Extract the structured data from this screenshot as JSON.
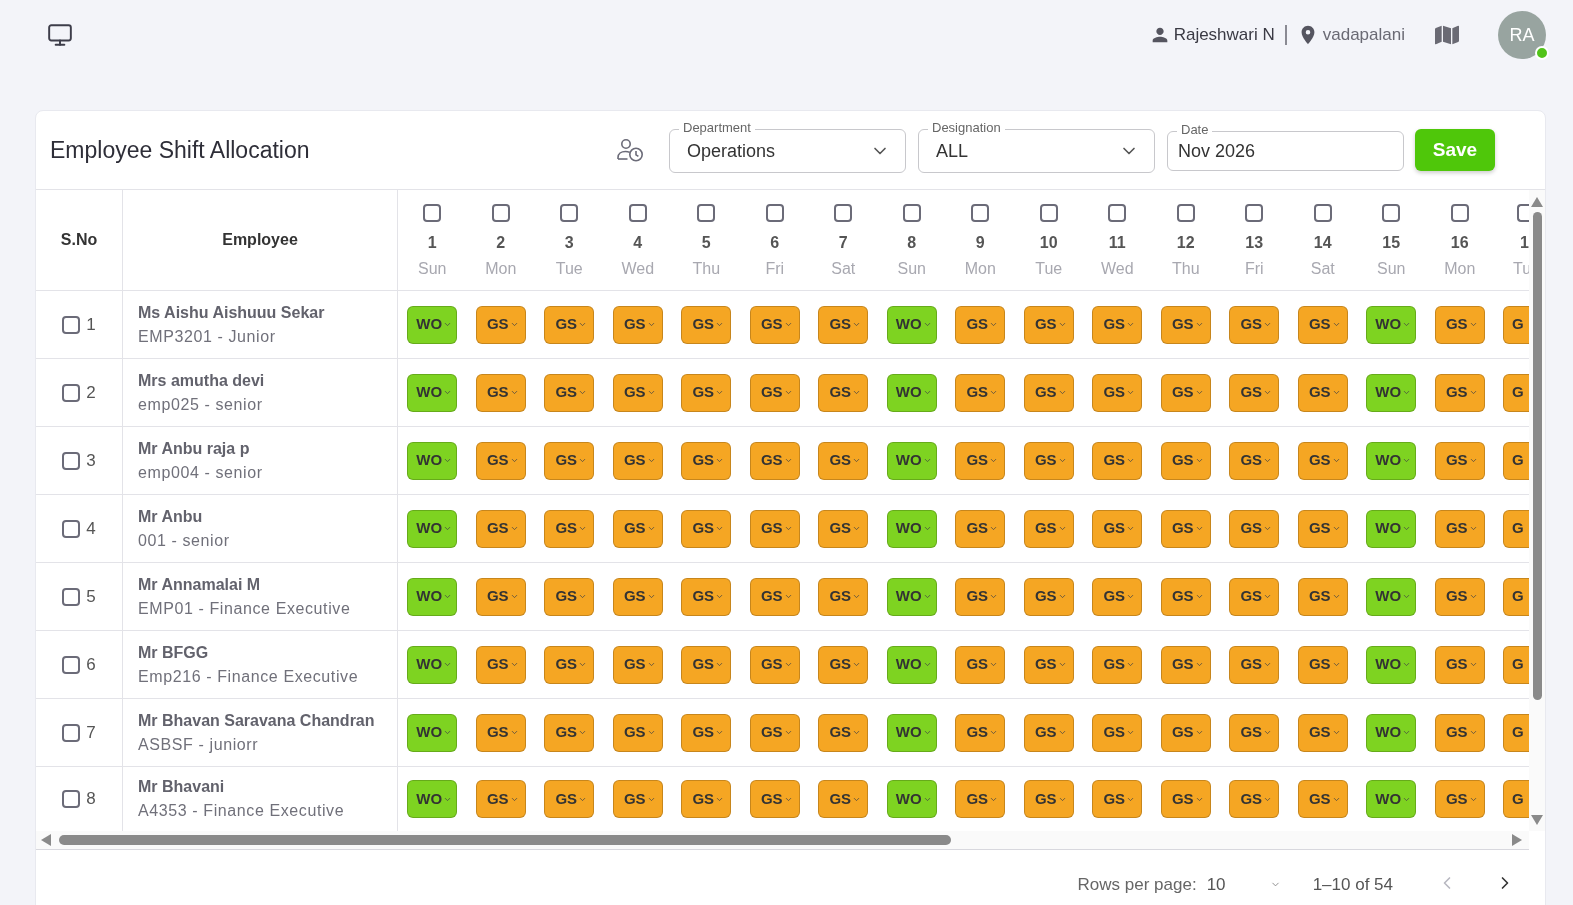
{
  "top_bar": {
    "user_name": "Rajeshwari N",
    "location": "vadapalani",
    "avatar_initials": "RA",
    "online": true
  },
  "page": {
    "title": "Employee Shift Allocation",
    "filters": [
      {
        "kind": "select",
        "label": "Department",
        "value": "Operations"
      },
      {
        "kind": "select",
        "label": "Designation",
        "value": "ALL"
      },
      {
        "kind": "date",
        "label": "Date",
        "value": "Nov 2026"
      }
    ],
    "save_button": "Save"
  },
  "table": {
    "columns": [
      "S.No",
      "Employee"
    ],
    "days": [
      {
        "number": "1",
        "weekday": "Sun",
        "checked": false
      },
      {
        "number": "2",
        "weekday": "Mon",
        "checked": false
      },
      {
        "number": "3",
        "weekday": "Tue",
        "checked": false
      },
      {
        "number": "4",
        "weekday": "Wed",
        "checked": false
      },
      {
        "number": "5",
        "weekday": "Thu",
        "checked": false
      },
      {
        "number": "6",
        "weekday": "Fri",
        "checked": false
      },
      {
        "number": "7",
        "weekday": "Sat",
        "checked": false
      },
      {
        "number": "8",
        "weekday": "Sun",
        "checked": false
      },
      {
        "number": "9",
        "weekday": "Mon",
        "checked": false
      },
      {
        "number": "10",
        "weekday": "Tue",
        "checked": false
      },
      {
        "number": "11",
        "weekday": "Wed",
        "checked": false
      },
      {
        "number": "12",
        "weekday": "Thu",
        "checked": false
      },
      {
        "number": "13",
        "weekday": "Fri",
        "checked": false
      },
      {
        "number": "14",
        "weekday": "Sat",
        "checked": false
      },
      {
        "number": "15",
        "weekday": "Sun",
        "checked": false
      },
      {
        "number": "16",
        "weekday": "Mon",
        "checked": false
      },
      {
        "number": "1",
        "weekday": "Tu",
        "checked": false
      }
    ],
    "rows": [
      {
        "sno": "1",
        "checked": false,
        "name": "Ms Aishu Aishuuu Sekar",
        "detail": "EMP3201 - Junior",
        "shifts": [
          {
            "code": "WO",
            "color": "#7ed321"
          },
          {
            "code": "GS",
            "color": "#f5a623"
          },
          {
            "code": "GS",
            "color": "#f5a623"
          },
          {
            "code": "GS",
            "color": "#f5a623"
          },
          {
            "code": "GS",
            "color": "#f5a623"
          },
          {
            "code": "GS",
            "color": "#f5a623"
          },
          {
            "code": "GS",
            "color": "#f5a623"
          },
          {
            "code": "WO",
            "color": "#7ed321"
          },
          {
            "code": "GS",
            "color": "#f5a623"
          },
          {
            "code": "GS",
            "color": "#f5a623"
          },
          {
            "code": "GS",
            "color": "#f5a623"
          },
          {
            "code": "GS",
            "color": "#f5a623"
          },
          {
            "code": "GS",
            "color": "#f5a623"
          },
          {
            "code": "GS",
            "color": "#f5a623"
          },
          {
            "code": "WO",
            "color": "#7ed321"
          },
          {
            "code": "GS",
            "color": "#f5a623"
          },
          {
            "code": "G",
            "color": "#f5a623"
          }
        ]
      },
      {
        "sno": "2",
        "checked": false,
        "name": "Mrs amutha devi",
        "detail": "emp025 - senior",
        "shifts": [
          {
            "code": "WO",
            "color": "#7ed321"
          },
          {
            "code": "GS",
            "color": "#f5a623"
          },
          {
            "code": "GS",
            "color": "#f5a623"
          },
          {
            "code": "GS",
            "color": "#f5a623"
          },
          {
            "code": "GS",
            "color": "#f5a623"
          },
          {
            "code": "GS",
            "color": "#f5a623"
          },
          {
            "code": "GS",
            "color": "#f5a623"
          },
          {
            "code": "WO",
            "color": "#7ed321"
          },
          {
            "code": "GS",
            "color": "#f5a623"
          },
          {
            "code": "GS",
            "color": "#f5a623"
          },
          {
            "code": "GS",
            "color": "#f5a623"
          },
          {
            "code": "GS",
            "color": "#f5a623"
          },
          {
            "code": "GS",
            "color": "#f5a623"
          },
          {
            "code": "GS",
            "color": "#f5a623"
          },
          {
            "code": "WO",
            "color": "#7ed321"
          },
          {
            "code": "GS",
            "color": "#f5a623"
          },
          {
            "code": "G",
            "color": "#f5a623"
          }
        ]
      },
      {
        "sno": "3",
        "checked": false,
        "name": "Mr Anbu raja p",
        "detail": "emp004 - senior",
        "shifts": [
          {
            "code": "WO",
            "color": "#7ed321"
          },
          {
            "code": "GS",
            "color": "#f5a623"
          },
          {
            "code": "GS",
            "color": "#f5a623"
          },
          {
            "code": "GS",
            "color": "#f5a623"
          },
          {
            "code": "GS",
            "color": "#f5a623"
          },
          {
            "code": "GS",
            "color": "#f5a623"
          },
          {
            "code": "GS",
            "color": "#f5a623"
          },
          {
            "code": "WO",
            "color": "#7ed321"
          },
          {
            "code": "GS",
            "color": "#f5a623"
          },
          {
            "code": "GS",
            "color": "#f5a623"
          },
          {
            "code": "GS",
            "color": "#f5a623"
          },
          {
            "code": "GS",
            "color": "#f5a623"
          },
          {
            "code": "GS",
            "color": "#f5a623"
          },
          {
            "code": "GS",
            "color": "#f5a623"
          },
          {
            "code": "WO",
            "color": "#7ed321"
          },
          {
            "code": "GS",
            "color": "#f5a623"
          },
          {
            "code": "G",
            "color": "#f5a623"
          }
        ]
      },
      {
        "sno": "4",
        "checked": false,
        "name": "Mr Anbu",
        "detail": "001 - senior",
        "shifts": [
          {
            "code": "WO",
            "color": "#7ed321"
          },
          {
            "code": "GS",
            "color": "#f5a623"
          },
          {
            "code": "GS",
            "color": "#f5a623"
          },
          {
            "code": "GS",
            "color": "#f5a623"
          },
          {
            "code": "GS",
            "color": "#f5a623"
          },
          {
            "code": "GS",
            "color": "#f5a623"
          },
          {
            "code": "GS",
            "color": "#f5a623"
          },
          {
            "code": "WO",
            "color": "#7ed321"
          },
          {
            "code": "GS",
            "color": "#f5a623"
          },
          {
            "code": "GS",
            "color": "#f5a623"
          },
          {
            "code": "GS",
            "color": "#f5a623"
          },
          {
            "code": "GS",
            "color": "#f5a623"
          },
          {
            "code": "GS",
            "color": "#f5a623"
          },
          {
            "code": "GS",
            "color": "#f5a623"
          },
          {
            "code": "WO",
            "color": "#7ed321"
          },
          {
            "code": "GS",
            "color": "#f5a623"
          },
          {
            "code": "G",
            "color": "#f5a623"
          }
        ]
      },
      {
        "sno": "5",
        "checked": false,
        "name": "Mr Annamalai M",
        "detail": "EMP01 - Finance Executive",
        "shifts": [
          {
            "code": "WO",
            "color": "#7ed321"
          },
          {
            "code": "GS",
            "color": "#f5a623"
          },
          {
            "code": "GS",
            "color": "#f5a623"
          },
          {
            "code": "GS",
            "color": "#f5a623"
          },
          {
            "code": "GS",
            "color": "#f5a623"
          },
          {
            "code": "GS",
            "color": "#f5a623"
          },
          {
            "code": "GS",
            "color": "#f5a623"
          },
          {
            "code": "WO",
            "color": "#7ed321"
          },
          {
            "code": "GS",
            "color": "#f5a623"
          },
          {
            "code": "GS",
            "color": "#f5a623"
          },
          {
            "code": "GS",
            "color": "#f5a623"
          },
          {
            "code": "GS",
            "color": "#f5a623"
          },
          {
            "code": "GS",
            "color": "#f5a623"
          },
          {
            "code": "GS",
            "color": "#f5a623"
          },
          {
            "code": "WO",
            "color": "#7ed321"
          },
          {
            "code": "GS",
            "color": "#f5a623"
          },
          {
            "code": "G",
            "color": "#f5a623"
          }
        ]
      },
      {
        "sno": "6",
        "checked": false,
        "name": "Mr BFGG",
        "detail": "Emp216 - Finance Executive",
        "shifts": [
          {
            "code": "WO",
            "color": "#7ed321"
          },
          {
            "code": "GS",
            "color": "#f5a623"
          },
          {
            "code": "GS",
            "color": "#f5a623"
          },
          {
            "code": "GS",
            "color": "#f5a623"
          },
          {
            "code": "GS",
            "color": "#f5a623"
          },
          {
            "code": "GS",
            "color": "#f5a623"
          },
          {
            "code": "GS",
            "color": "#f5a623"
          },
          {
            "code": "WO",
            "color": "#7ed321"
          },
          {
            "code": "GS",
            "color": "#f5a623"
          },
          {
            "code": "GS",
            "color": "#f5a623"
          },
          {
            "code": "GS",
            "color": "#f5a623"
          },
          {
            "code": "GS",
            "color": "#f5a623"
          },
          {
            "code": "GS",
            "color": "#f5a623"
          },
          {
            "code": "GS",
            "color": "#f5a623"
          },
          {
            "code": "WO",
            "color": "#7ed321"
          },
          {
            "code": "GS",
            "color": "#f5a623"
          },
          {
            "code": "G",
            "color": "#f5a623"
          }
        ]
      },
      {
        "sno": "7",
        "checked": false,
        "name": "Mr Bhavan Saravana Chandran",
        "detail": "ASBSF - juniorr",
        "shifts": [
          {
            "code": "WO",
            "color": "#7ed321"
          },
          {
            "code": "GS",
            "color": "#f5a623"
          },
          {
            "code": "GS",
            "color": "#f5a623"
          },
          {
            "code": "GS",
            "color": "#f5a623"
          },
          {
            "code": "GS",
            "color": "#f5a623"
          },
          {
            "code": "GS",
            "color": "#f5a623"
          },
          {
            "code": "GS",
            "color": "#f5a623"
          },
          {
            "code": "WO",
            "color": "#7ed321"
          },
          {
            "code": "GS",
            "color": "#f5a623"
          },
          {
            "code": "GS",
            "color": "#f5a623"
          },
          {
            "code": "GS",
            "color": "#f5a623"
          },
          {
            "code": "GS",
            "color": "#f5a623"
          },
          {
            "code": "GS",
            "color": "#f5a623"
          },
          {
            "code": "GS",
            "color": "#f5a623"
          },
          {
            "code": "WO",
            "color": "#7ed321"
          },
          {
            "code": "GS",
            "color": "#f5a623"
          },
          {
            "code": "G",
            "color": "#f5a623"
          }
        ]
      },
      {
        "sno": "8",
        "checked": false,
        "name": "Mr Bhavani",
        "detail": "A4353 - Finance Executive",
        "shifts": [
          {
            "code": "WO",
            "color": "#7ed321"
          },
          {
            "code": "GS",
            "color": "#f5a623"
          },
          {
            "code": "GS",
            "color": "#f5a623"
          },
          {
            "code": "GS",
            "color": "#f5a623"
          },
          {
            "code": "GS",
            "color": "#f5a623"
          },
          {
            "code": "GS",
            "color": "#f5a623"
          },
          {
            "code": "GS",
            "color": "#f5a623"
          },
          {
            "code": "WO",
            "color": "#7ed321"
          },
          {
            "code": "GS",
            "color": "#f5a623"
          },
          {
            "code": "GS",
            "color": "#f5a623"
          },
          {
            "code": "GS",
            "color": "#f5a623"
          },
          {
            "code": "GS",
            "color": "#f5a623"
          },
          {
            "code": "GS",
            "color": "#f5a623"
          },
          {
            "code": "GS",
            "color": "#f5a623"
          },
          {
            "code": "WO",
            "color": "#7ed321"
          },
          {
            "code": "GS",
            "color": "#f5a623"
          },
          {
            "code": "G",
            "color": "#f5a623"
          }
        ]
      }
    ]
  },
  "pagination": {
    "rows_per_page_label": "Rows per page:",
    "rows_per_page": "10",
    "range": "1–10 of 54",
    "previous": {
      "disabled": true
    },
    "next": {
      "disabled": false
    }
  }
}
